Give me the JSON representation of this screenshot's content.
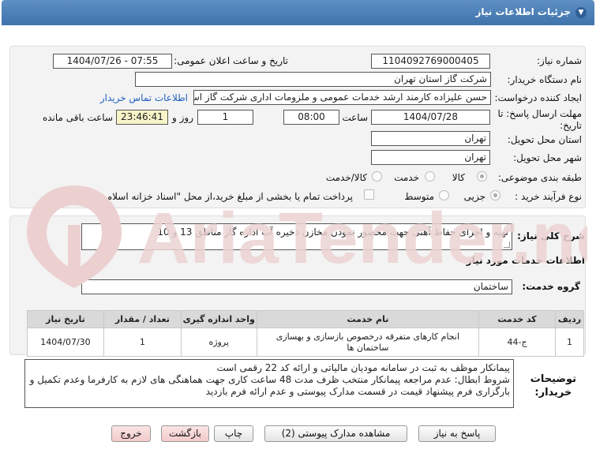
{
  "header": {
    "title": "جزئیات اطلاعات نیاز"
  },
  "fields": {
    "need_number_label": "شماره نیاز:",
    "need_number": "1104092769000405",
    "announce_label": "تاریخ و ساعت اعلان عمومی:",
    "announce_value": "1404/07/26 - 07:55",
    "buyer_org_label": "نام دستگاه خریدار:",
    "buyer_org": "شرکت گاز استان تهران",
    "creator_label": "ایجاد کننده درخواست:",
    "creator": "حسن علیزاده کارمند ارشد خدمات عمومی و ملزومات اداری شرکت گاز استان تهران",
    "contact_link": "اطلاعات تماس خریدار",
    "deadline_label_1": "مهلت ارسال پاسخ: تا",
    "deadline_label_2": "تاریخ:",
    "deadline_date": "1404/07/28",
    "time_label": "ساعت",
    "deadline_time": "08:00",
    "days_value": "1",
    "days_label": "روز و",
    "remaining_time": "23:46:41",
    "remaining_label": "ساعت باقی مانده",
    "province_label": "استان محل تحویل:",
    "province": "تهران",
    "city_label": "شهر محل تحویل:",
    "city": "تهران",
    "category_label": "طبقه بندی موضوعی:",
    "category_options": [
      "کالا",
      "خدمت",
      "کالا/خدمت"
    ],
    "process_label": "نوع فرآیند خرید :",
    "process_options": [
      "جزیی",
      "متوسط"
    ],
    "payment_note": "پرداخت تمام یا بخشی از مبلغ خرید،از محل \"اسناد خزانه اسلامی\" خواهد بود."
  },
  "summary": {
    "label": "شرح کلی نیاز:",
    "text": "تهیه و اجرای حفاظ آهنی جهت محصور نمودن مخازن ذخیره آب اداره گاز مناطق 13 و 10"
  },
  "services_section": {
    "title": "اطلاعات خدمات مورد نیاز",
    "group_label": "گروه خدمت:",
    "group_value": "ساختمان"
  },
  "table": {
    "headers": [
      "ردیف",
      "کد خدمت",
      "نام خدمت",
      "واحد اندازه گیری",
      "تعداد / مقدار",
      "تاریخ نیاز"
    ],
    "rows": [
      [
        "1",
        "ج-44",
        "انجام کارهای متفرقه درخصوص بازسازی و بهسازی ساختمان ها",
        "پروژه",
        "1",
        "1404/07/30"
      ]
    ]
  },
  "buyer_notes": {
    "label_1": "توضیحات",
    "label_2": "خریدار:",
    "lines": [
      "پیمانکار موظف به ثبت در سامانه مودیان مالیاتی و ارائه کد 22 رقمی است",
      "شروط ابطال: عدم مراجعه پیمانکار منتخب ظرف مدت 48 ساعت کاری جهت هماهنگی های لازم به کارفرما وعدم تکمیل و",
      "بارگزاری فرم پیشنهاد قیمت در قسمت مدارک پیوستی و عدم ارائه فرم بازدید"
    ]
  },
  "buttons": {
    "reply": "پاسخ به نیاز",
    "attachments": "مشاهده مدارک پیوستی (2)",
    "print": "چاپ",
    "back": "بازگشت",
    "exit": "خروج"
  },
  "watermark": {
    "text": "AriaTender.net"
  },
  "colors": {
    "header": "#4a7fb8",
    "watermark": "#e9c4c4",
    "link": "#2060c0"
  }
}
